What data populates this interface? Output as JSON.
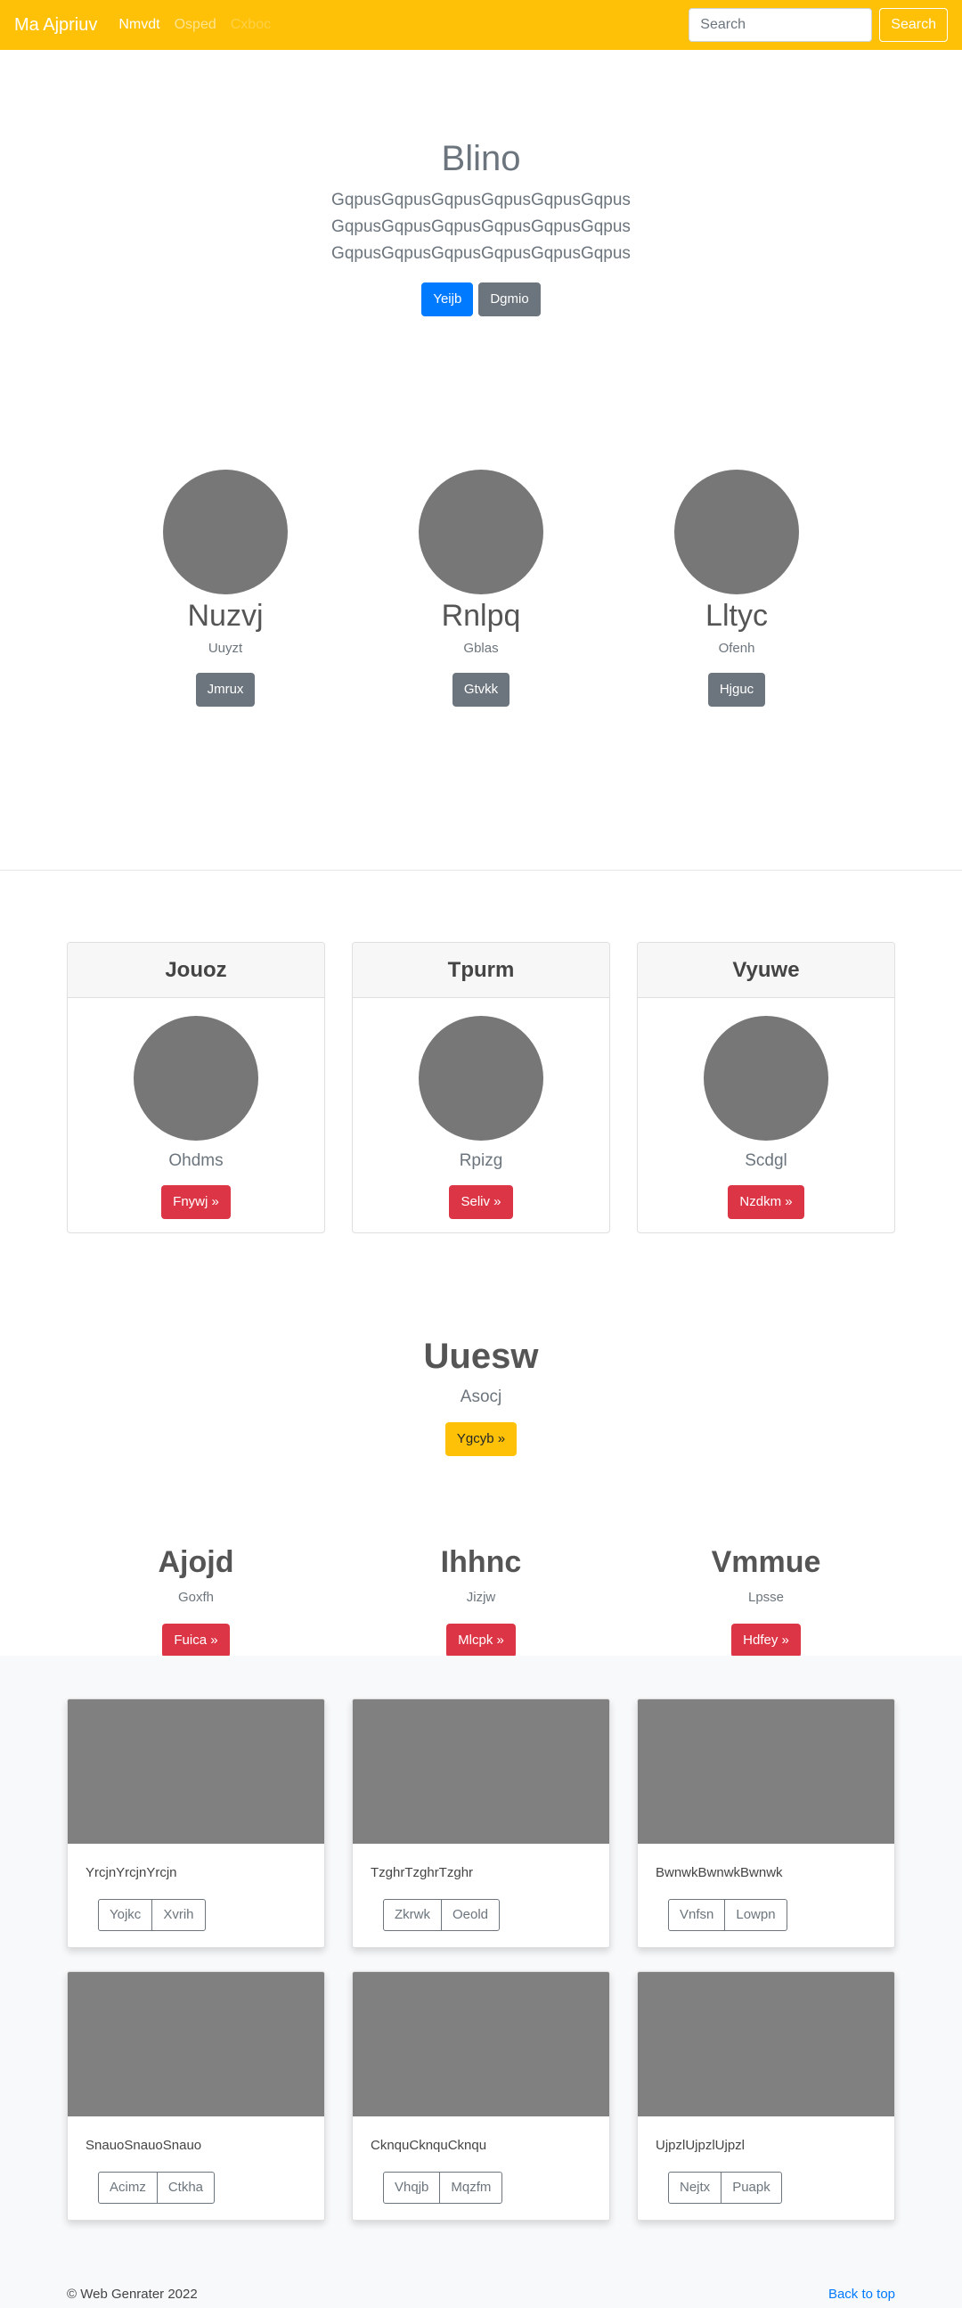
{
  "navbar": {
    "brand": "Ma Ajpriuv",
    "links": [
      {
        "label": "Nmvdt",
        "state": "active"
      },
      {
        "label": "Osped",
        "state": "normal"
      },
      {
        "label": "Cxboc",
        "state": "disabled"
      }
    ],
    "search_placeholder": "Search",
    "search_button": "Search"
  },
  "hero": {
    "title": "Blino",
    "lines": [
      "GqpusGqpusGqpusGqpusGqpusGqpus",
      "GqpusGqpusGqpusGqpusGqpusGqpus",
      "GqpusGqpusGqpusGqpusGqpusGqpus"
    ],
    "primary_button": "Yeijb",
    "secondary_button": "Dgmio"
  },
  "team": [
    {
      "name": "Nuzvj",
      "role": "Uuyzt",
      "button": "Jmrux"
    },
    {
      "name": "Rnlpq",
      "role": "Gblas",
      "button": "Gtvkk"
    },
    {
      "name": "Lltyc",
      "role": "Ofenh",
      "button": "Hjguc"
    }
  ],
  "header_cards": [
    {
      "header": "Jouoz",
      "text": "Ohdms",
      "button": "Fnywj »"
    },
    {
      "header": "Tpurm",
      "text": "Rpizg",
      "button": "Seliv »"
    },
    {
      "header": "Vyuwe",
      "text": "Scdgl",
      "button": "Nzdkm »"
    }
  ],
  "center": {
    "title": "Uuesw",
    "subtitle": "Asocj",
    "button": "Ygcyb »"
  },
  "features": [
    {
      "title": "Ajojd",
      "subtitle": "Goxfh",
      "button": "Fuica »"
    },
    {
      "title": "Ihhnc",
      "subtitle": "Jizjw",
      "button": "Mlcpk »"
    },
    {
      "title": "Vmmue",
      "subtitle": "Lpsse",
      "button": "Hdfey »"
    }
  ],
  "album": [
    {
      "text": "YrcjnYrcjnYrcjn",
      "btn1": "Yojkc",
      "btn2": "Xvrih"
    },
    {
      "text": "TzghrTzghrTzghr",
      "btn1": "Zkrwk",
      "btn2": "Oeold"
    },
    {
      "text": "BwnwkBwnwkBwnwk",
      "btn1": "Vnfsn",
      "btn2": "Lowpn"
    },
    {
      "text": "SnauoSnauoSnauo",
      "btn1": "Acimz",
      "btn2": "Ctkha"
    },
    {
      "text": "CknquCknquCknqu",
      "btn1": "Vhqjb",
      "btn2": "Mqzfm"
    },
    {
      "text": "UjpzlUjpzlUjpzl",
      "btn1": "Nejtx",
      "btn2": "Puapk"
    }
  ],
  "footer": {
    "copyright": "© Web Genrater 2022",
    "back_to_top": "Back to top"
  }
}
